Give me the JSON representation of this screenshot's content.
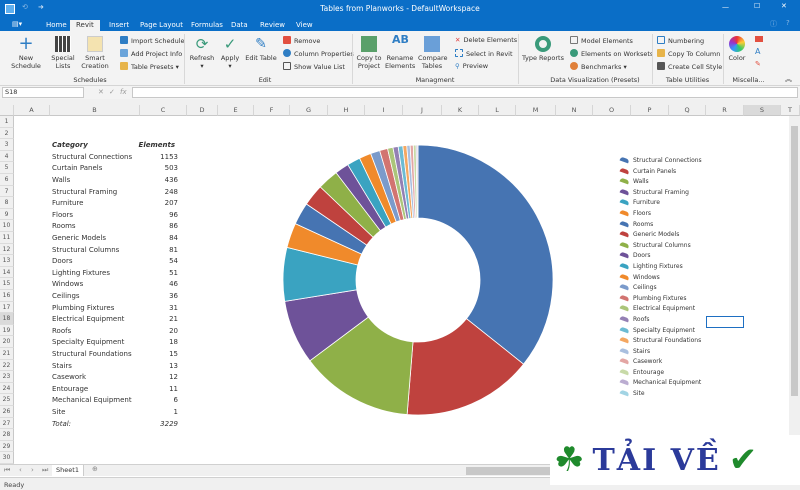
{
  "window": {
    "title": "Tables from Planworks - DefaultWorkspace"
  },
  "tabs": [
    "Home",
    "Revit",
    "Insert",
    "Page Layout",
    "Formulas",
    "Data",
    "Review",
    "View"
  ],
  "active_tab": "Revit",
  "ribbon": {
    "schedules": {
      "label": "Schedules",
      "new_schedule": "New Schedule",
      "special_lists": "Special Lists",
      "smart_creation": "Smart Creation",
      "import_schedule": "Import Schedule",
      "add_project_info": "Add Project Info",
      "table_presets": "Table Presets"
    },
    "edit": {
      "label": "Edit",
      "refresh": "Refresh",
      "apply": "Apply",
      "edit_table": "Edit Table",
      "remove": "Remove",
      "column_properties": "Column Properties",
      "show_value_list": "Show Value List"
    },
    "management": {
      "label": "Managment",
      "copy_to_project": "Copy to Project",
      "rename_elements": "Rename Elements",
      "compare_tables": "Compare Tables",
      "delete_elements": "Delete Elements",
      "select_in_revit": "Select in Revit",
      "preview": "Preview"
    },
    "data_viz": {
      "label": "Data Visualization (Presets)",
      "type_reports": "Type Reports",
      "model_elements": "Model Elements",
      "elements_on_worksets": "Elements on Worksets",
      "benchmarks": "Benchmarks"
    },
    "table_utilities": {
      "label": "Table Utilities",
      "numbering": "Numbering",
      "copy_to_column": "Copy To Column",
      "create_cell_style": "Create Cell Style"
    },
    "misc": {
      "label": "Miscella...",
      "color": "Color"
    }
  },
  "formula_bar": {
    "name_box": "S18",
    "formula": ""
  },
  "columns": [
    "A",
    "B",
    "C",
    "D",
    "E",
    "F",
    "G",
    "H",
    "I",
    "J",
    "K",
    "L",
    "M",
    "N",
    "O",
    "P",
    "Q",
    "R",
    "S",
    "T"
  ],
  "table": {
    "header_category": "Category",
    "header_elements": "Elements",
    "rows": [
      [
        "Structural Connections",
        1153
      ],
      [
        "Curtain Panels",
        503
      ],
      [
        "Walls",
        436
      ],
      [
        "Structural Framing",
        248
      ],
      [
        "Furniture",
        207
      ],
      [
        "Floors",
        96
      ],
      [
        "Rooms",
        86
      ],
      [
        "Generic Models",
        84
      ],
      [
        "Structural Columns",
        81
      ],
      [
        "Doors",
        54
      ],
      [
        "Lighting Fixtures",
        51
      ],
      [
        "Windows",
        46
      ],
      [
        "Ceilings",
        36
      ],
      [
        "Plumbing Fixtures",
        31
      ],
      [
        "Electrical Equipment",
        21
      ],
      [
        "Roofs",
        20
      ],
      [
        "Specialty Equipment",
        18
      ],
      [
        "Structural Foundations",
        15
      ],
      [
        "Stairs",
        13
      ],
      [
        "Casework",
        12
      ],
      [
        "Entourage",
        11
      ],
      [
        "Mechanical Equipment",
        6
      ],
      [
        "Site",
        1
      ]
    ],
    "total_label": "Total:",
    "total_value": 3229
  },
  "chart_data": {
    "type": "pie",
    "style": "doughnut",
    "legend": "right",
    "categories": [
      "Structural Connections",
      "Curtain Panels",
      "Walls",
      "Structural Framing",
      "Furniture",
      "Floors",
      "Rooms",
      "Generic Models",
      "Structural Columns",
      "Doors",
      "Lighting Fixtures",
      "Windows",
      "Ceilings",
      "Plumbing Fixtures",
      "Electrical Equipment",
      "Roofs",
      "Specialty Equipment",
      "Structural Foundations",
      "Stairs",
      "Casework",
      "Entourage",
      "Mechanical Equipment",
      "Site"
    ],
    "values": [
      1153,
      503,
      436,
      248,
      207,
      96,
      86,
      84,
      81,
      54,
      51,
      46,
      36,
      31,
      21,
      20,
      18,
      15,
      13,
      12,
      11,
      6,
      1
    ],
    "colors": [
      "#4674b2",
      "#bf423e",
      "#8fb048",
      "#6e5299",
      "#3aa3c1",
      "#f08a2b",
      "#4674b2",
      "#bf423e",
      "#8fb048",
      "#6e5299",
      "#3aa3c1",
      "#f08a2b",
      "#7b9bcb",
      "#d27471",
      "#abc57a",
      "#9480b4",
      "#6cbbd3",
      "#f4a761",
      "#a9bfdf",
      "#e3a6a4",
      "#c8daa8",
      "#bbadd1",
      "#a2d4e4"
    ]
  },
  "sheet": {
    "name": "Sheet1"
  },
  "status": "Ready",
  "watermark": "TẢI VỀ"
}
